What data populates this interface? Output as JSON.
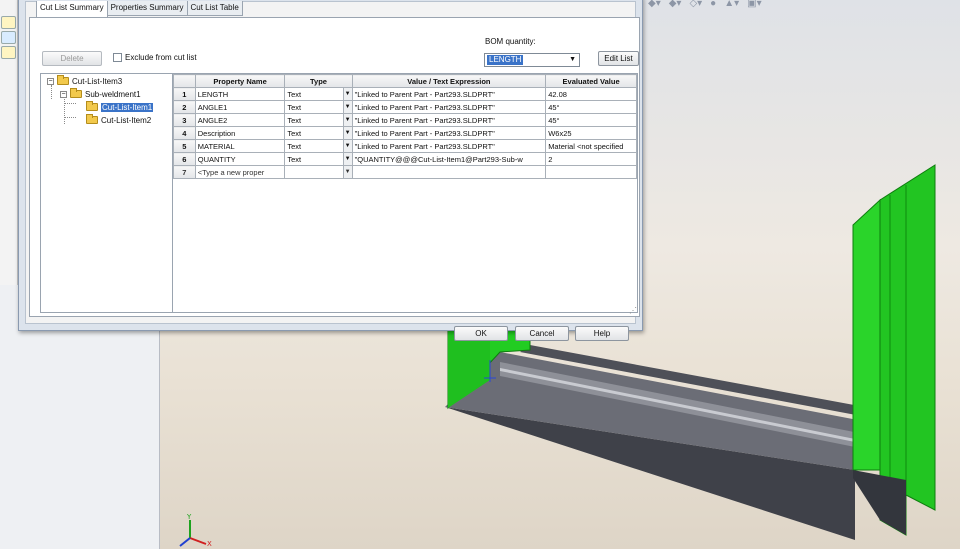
{
  "dialog": {
    "tabs": [
      {
        "label": "Cut List Summary",
        "active": true
      },
      {
        "label": "Properties Summary",
        "active": false
      },
      {
        "label": "Cut List Table",
        "active": false
      }
    ],
    "delete_label": "Delete",
    "exclude_label": "Exclude from cut list",
    "exclude_checked": false,
    "bom_label": "BOM quantity:",
    "bom_value": "LENGTH",
    "edit_list_label": "Edit List",
    "tree": [
      {
        "label": "Cut-List-Item3",
        "level": 0,
        "expanded": true,
        "selected": false
      },
      {
        "label": "Sub-weldment1",
        "level": 1,
        "expanded": true,
        "selected": false
      },
      {
        "label": "Cut-List-Item1",
        "level": 2,
        "selected": true
      },
      {
        "label": "Cut-List-Item2",
        "level": 2,
        "selected": false
      }
    ],
    "grid": {
      "headers": [
        "",
        "Property Name",
        "Type",
        "Value / Text Expression",
        "Evaluated Value"
      ],
      "rows": [
        {
          "num": "1",
          "name": "LENGTH",
          "type": "Text",
          "value": "\"Linked to Parent Part - Part293.SLDPRT\"",
          "evaluated": "42.08"
        },
        {
          "num": "2",
          "name": "ANGLE1",
          "type": "Text",
          "value": "\"Linked to Parent Part - Part293.SLDPRT\"",
          "evaluated": "45°"
        },
        {
          "num": "3",
          "name": "ANGLE2",
          "type": "Text",
          "value": "\"Linked to Parent Part - Part293.SLDPRT\"",
          "evaluated": "45°"
        },
        {
          "num": "4",
          "name": "Description",
          "type": "Text",
          "value": "\"Linked to Parent Part - Part293.SLDPRT\"",
          "evaluated": "W6x25"
        },
        {
          "num": "5",
          "name": "MATERIAL",
          "type": "Text",
          "value": "\"Linked to Parent Part - Part293.SLDPRT\"",
          "evaluated": "Material <not specified"
        },
        {
          "num": "6",
          "name": "QUANTITY",
          "type": "Text",
          "value": "\"QUANTITY@@@Cut-List-Item1@Part293-Sub-w",
          "evaluated": "2"
        },
        {
          "num": "7",
          "name": "<Type a new proper",
          "type": "",
          "value": "",
          "evaluated": ""
        }
      ]
    },
    "ok_label": "OK",
    "cancel_label": "Cancel",
    "help_label": "Help"
  },
  "triad": {
    "y_label": "Y",
    "x_label": "X"
  },
  "colors": {
    "model_green": "#1ed31e",
    "selection_blue": "#3a73c8",
    "steel_gray": "#5e6068"
  }
}
